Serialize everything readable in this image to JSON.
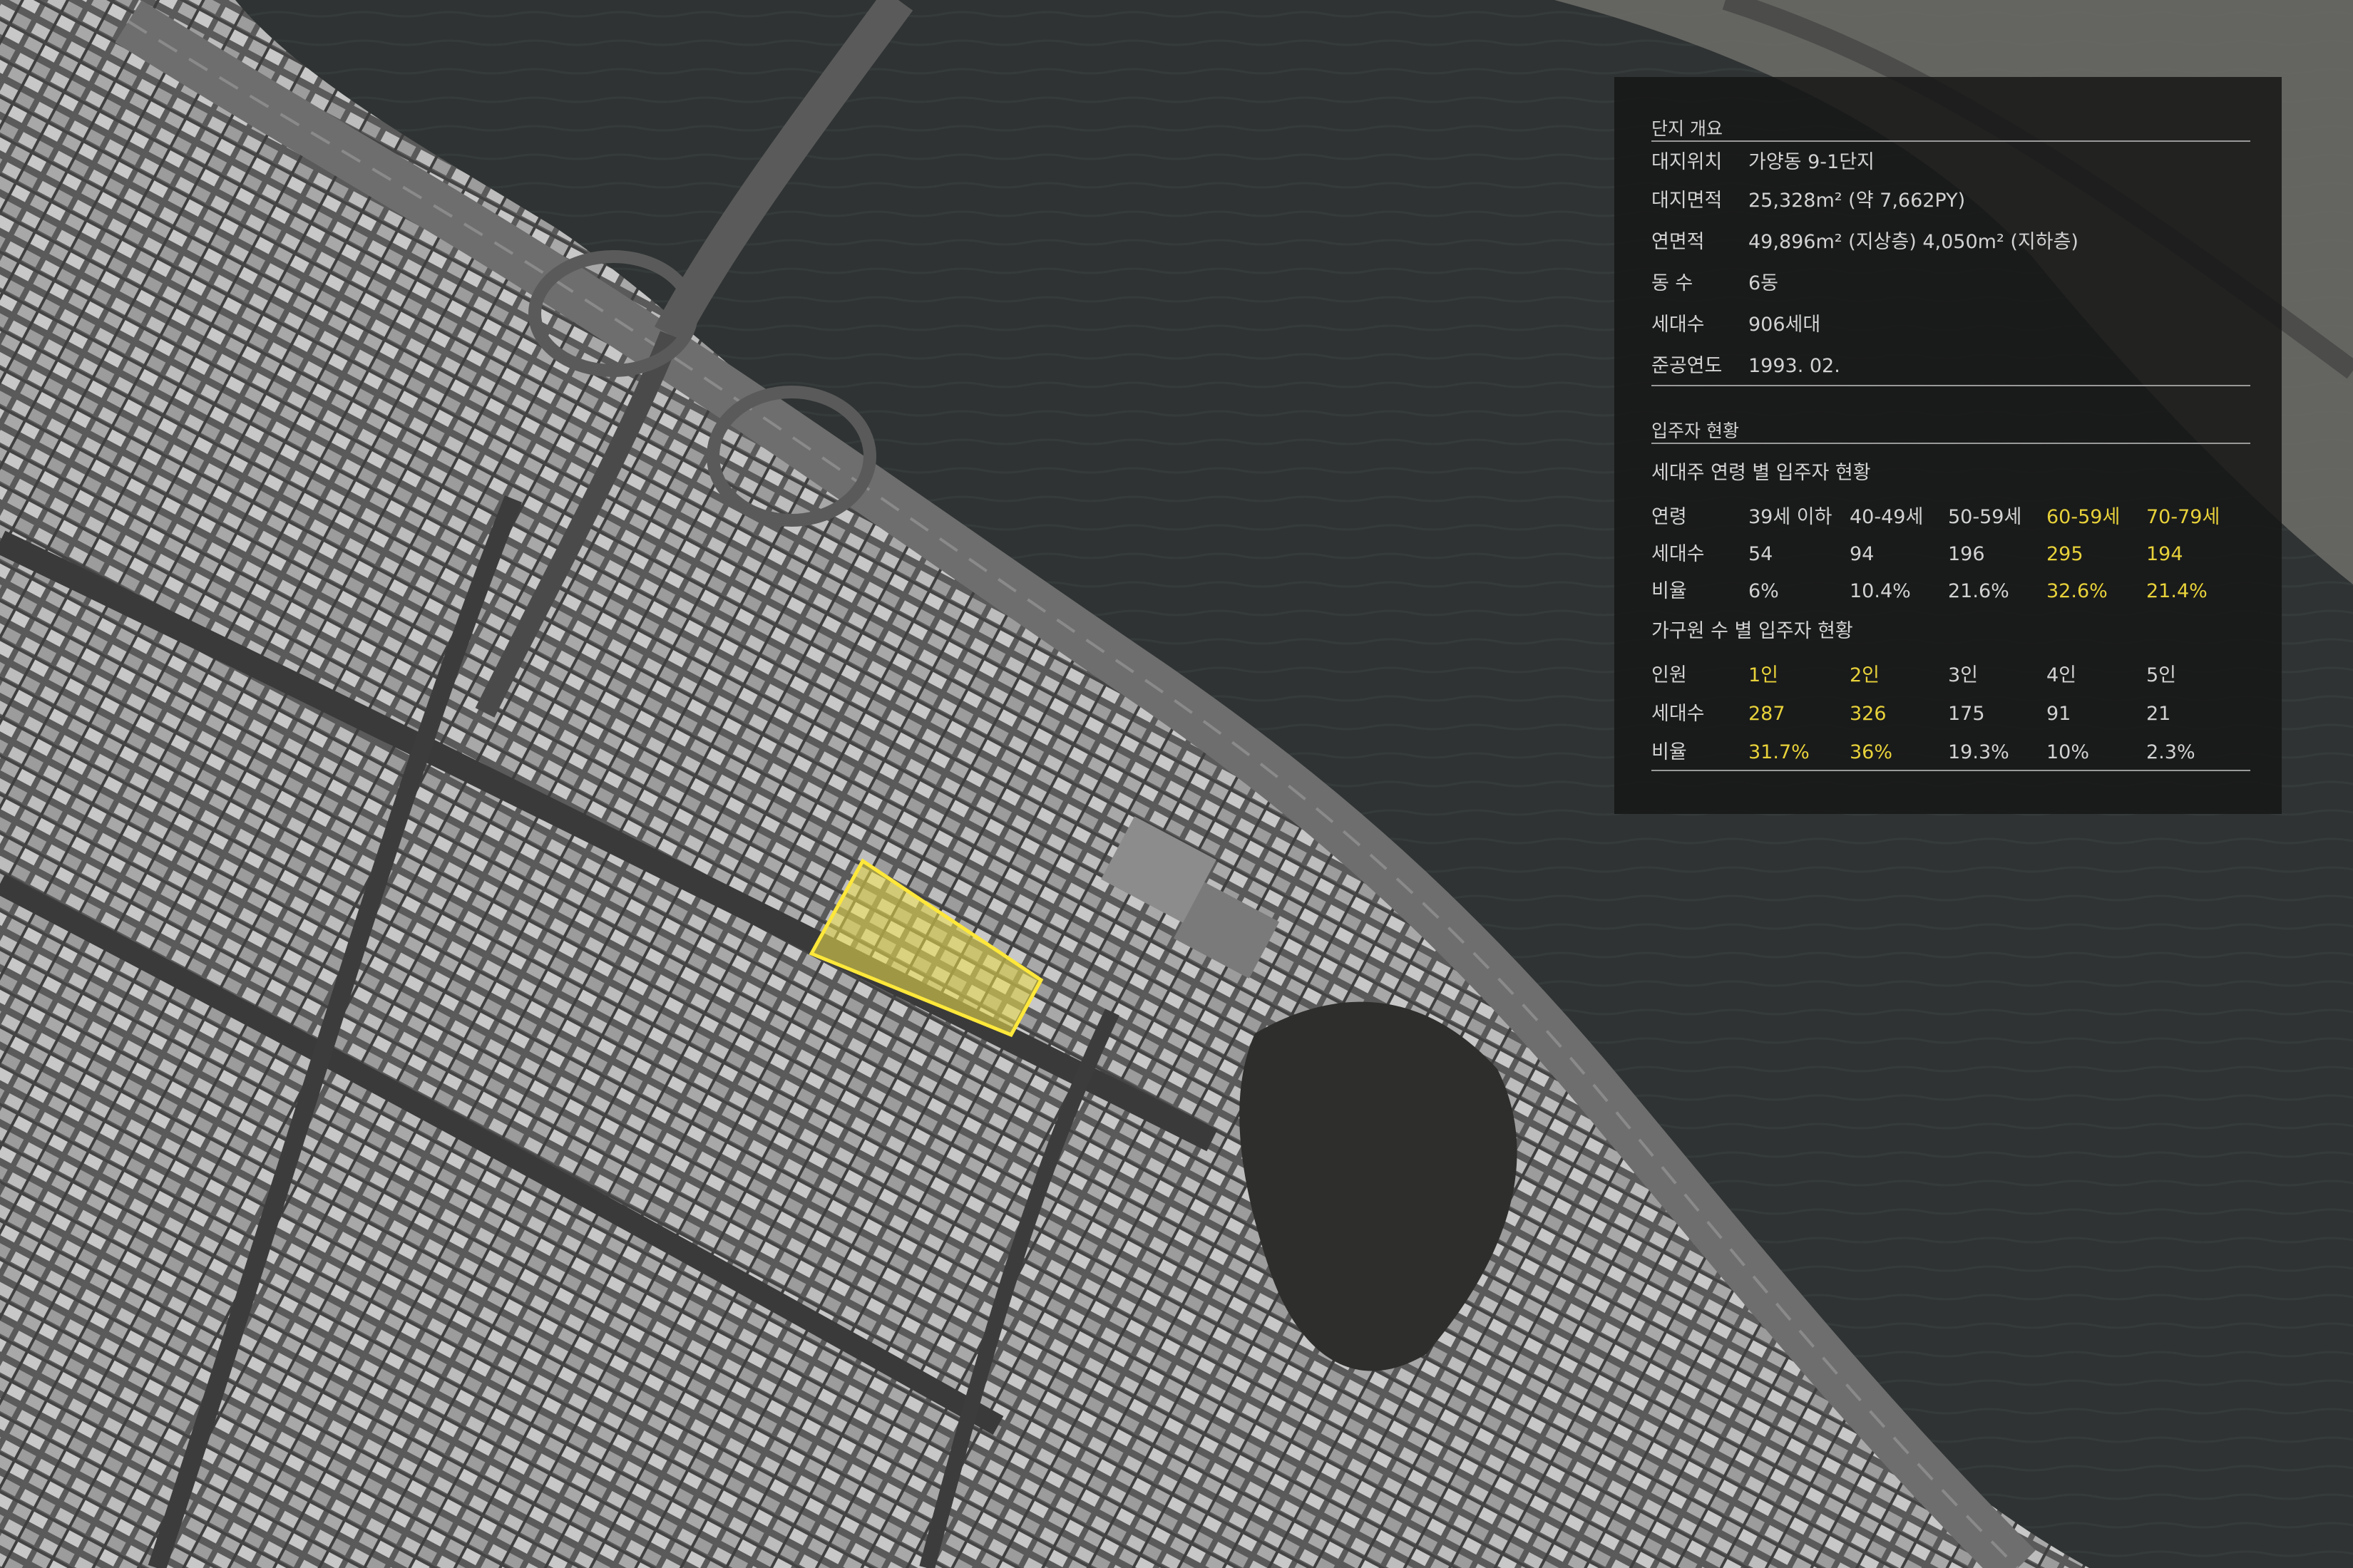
{
  "map": {
    "description_colors": {
      "river": "#2e3232",
      "site_highlight": "#f2e44a"
    }
  },
  "panel": {
    "overview": {
      "title": "단지 개요",
      "rows": [
        {
          "label": "대지위치",
          "value": "가양동 9-1단지"
        },
        {
          "label": "대지면적",
          "value": "25,328m² (약 7,662PY)"
        },
        {
          "label": "연면적",
          "value": "49,896m² (지상층) 4,050m² (지하층)"
        },
        {
          "label": "동 수",
          "value": "6동"
        },
        {
          "label": "세대수",
          "value": "906세대"
        },
        {
          "label": "준공연도",
          "value": "1993. 02."
        }
      ]
    },
    "residents": {
      "title": "입주자 현황",
      "age_table": {
        "title": "세대주 연령 별 입주자 현황",
        "rows": [
          {
            "label": "연령",
            "cells": [
              "39세 이하",
              "40-49세",
              "50-59세",
              "60-59세",
              "70-79세"
            ]
          },
          {
            "label": "세대수",
            "cells": [
              "54",
              "94",
              "196",
              "295",
              "194"
            ]
          },
          {
            "label": "비율",
            "cells": [
              "6%",
              "10.4%",
              "21.6%",
              "32.6%",
              "21.4%"
            ]
          }
        ],
        "highlight_columns": [
          3,
          4
        ]
      },
      "size_table": {
        "title": "가구원 수 별 입주자 현황",
        "rows": [
          {
            "label": "인원",
            "cells": [
              "1인",
              "2인",
              "3인",
              "4인",
              "5인"
            ]
          },
          {
            "label": "세대수",
            "cells": [
              "287",
              "326",
              "175",
              "91",
              "21"
            ]
          },
          {
            "label": "비율",
            "cells": [
              "31.7%",
              "36%",
              "19.3%",
              "10%",
              "2.3%"
            ]
          }
        ],
        "highlight_columns": [
          0,
          1
        ]
      }
    },
    "colors": {
      "highlight": "#e8d23a",
      "text": "#d2d2d2"
    }
  }
}
